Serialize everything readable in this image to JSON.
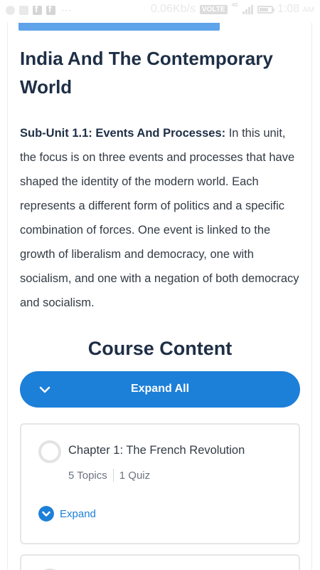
{
  "status_bar": {
    "speed": "0.06Kb/s",
    "volte": "VOLTE",
    "network": "4G",
    "time": "1:08",
    "ampm": "AM"
  },
  "content": {
    "title": "India And The Contemporary World",
    "subunit_label": "Sub-Unit 1.1: Events And Processes:",
    "description": " In this unit, the focus is on three events and processes that have shaped the identity of the modern world. Each represents a different form of politics and a specific combination of forces. One event is linked to the growth of liberalism and democracy, one with socialism, and one with a negation of both democracy and socialism."
  },
  "course": {
    "heading": "Course Content",
    "expand_all_label": "Expand All",
    "chapters": [
      {
        "title": "Chapter 1: The French Revolution",
        "topics": "5 Topics",
        "quiz": "1 Quiz",
        "expand_label": "Expand"
      }
    ]
  },
  "colors": {
    "accent": "#1c7fd8",
    "heading": "#1e2f46",
    "body_text": "#333b45"
  }
}
